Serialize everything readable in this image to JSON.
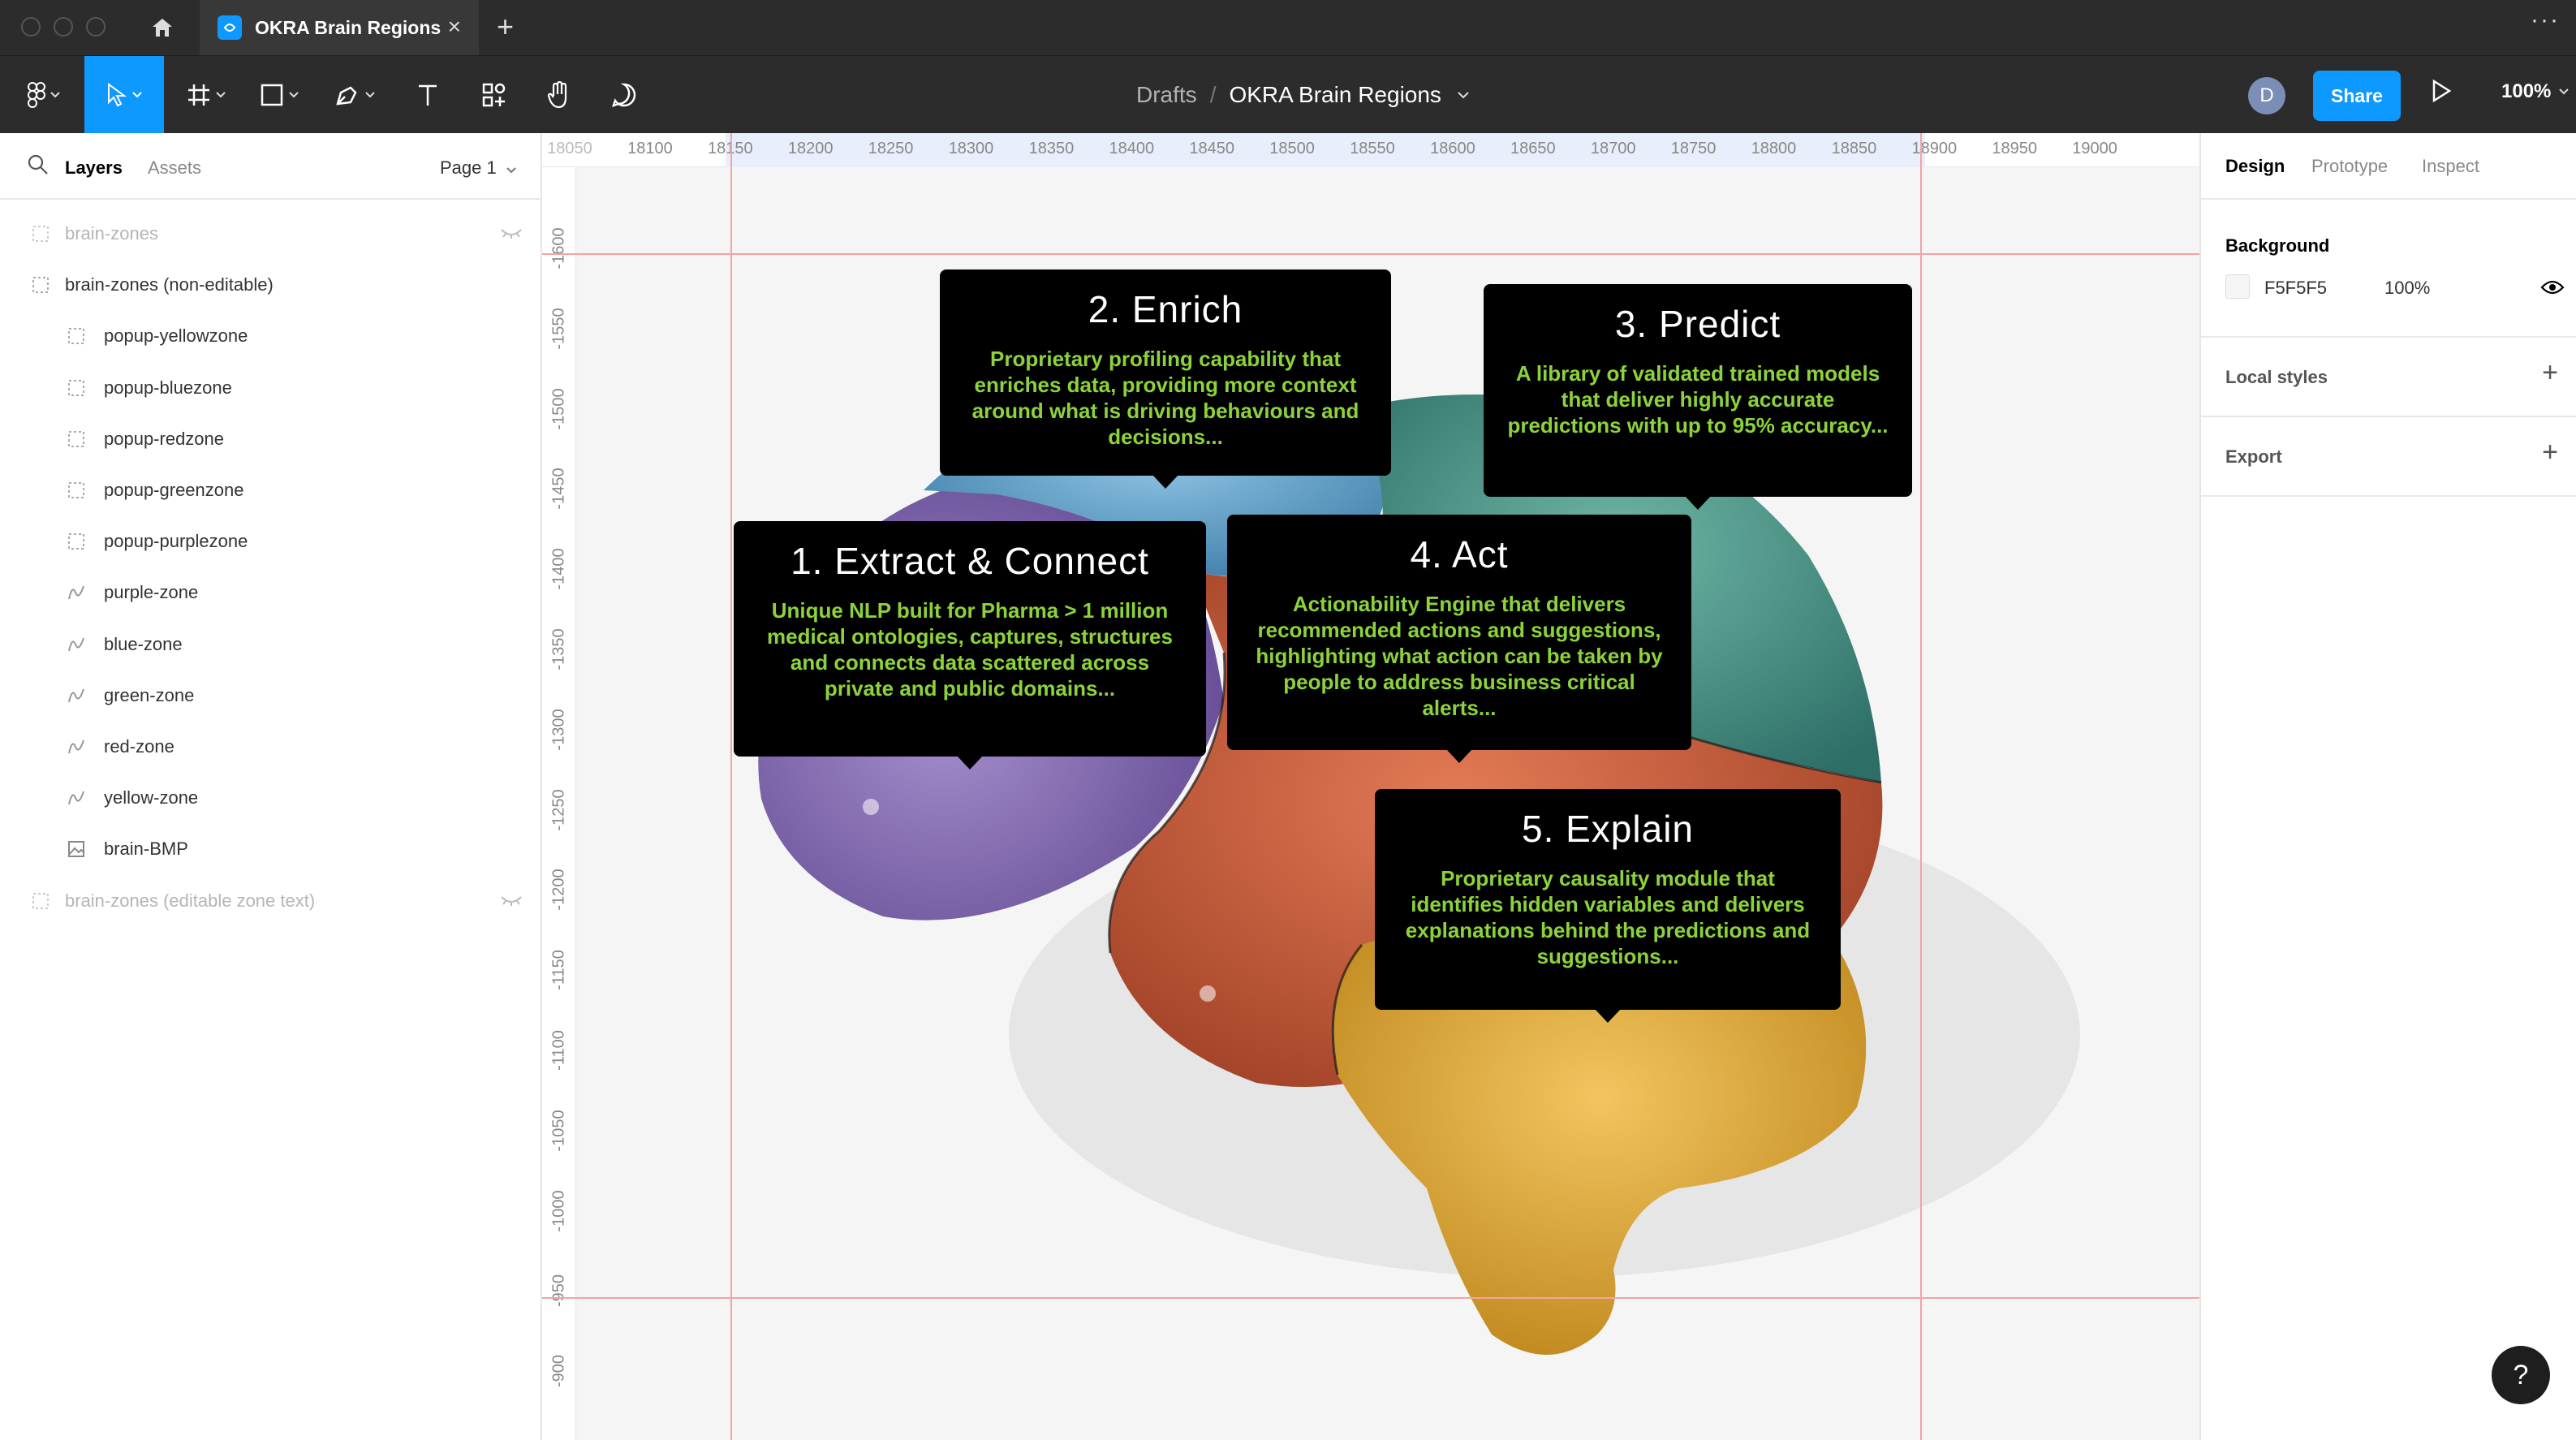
{
  "window": {
    "tab_title": "OKRA Brain Regions",
    "icons": [
      "home-icon",
      "figma-logo-icon",
      "close-icon",
      "plus-icon",
      "more-icon"
    ]
  },
  "toolbar": {
    "breadcrumb_drafts": "Drafts",
    "breadcrumb_sep": "/",
    "file_name": "OKRA Brain Regions",
    "avatar_initial": "D",
    "share_label": "Share",
    "zoom_label": "100%"
  },
  "left_panel": {
    "tab_layers": "Layers",
    "tab_assets": "Assets",
    "page_label": "Page 1",
    "layers": [
      {
        "name": "brain-zones",
        "type": "frame",
        "hidden": true
      },
      {
        "name": "brain-zones (non-editable)",
        "type": "frame",
        "hidden": false
      },
      {
        "name": "popup-yellowzone",
        "type": "frame",
        "hidden": false
      },
      {
        "name": "popup-bluezone",
        "type": "frame",
        "hidden": false
      },
      {
        "name": "popup-redzone",
        "type": "frame",
        "hidden": false
      },
      {
        "name": "popup-greenzone",
        "type": "frame",
        "hidden": false
      },
      {
        "name": "popup-purplezone",
        "type": "frame",
        "hidden": false
      },
      {
        "name": "purple-zone",
        "type": "vector",
        "hidden": false
      },
      {
        "name": "blue-zone",
        "type": "vector",
        "hidden": false
      },
      {
        "name": "green-zone",
        "type": "vector",
        "hidden": false
      },
      {
        "name": "red-zone",
        "type": "vector",
        "hidden": false
      },
      {
        "name": "yellow-zone",
        "type": "vector",
        "hidden": false
      },
      {
        "name": "brain-BMP",
        "type": "image",
        "hidden": false
      },
      {
        "name": "brain-zones (editable zone text)",
        "type": "frame",
        "hidden": true
      }
    ]
  },
  "rulers": {
    "top": [
      "18050",
      "18100",
      "18150",
      "18200",
      "18250",
      "18300",
      "18350",
      "18400",
      "18450",
      "18500",
      "18550",
      "18600",
      "18650",
      "18700",
      "18750",
      "18800",
      "18850",
      "18900",
      "18950",
      "19000"
    ],
    "left": [
      "-1600",
      "-1550",
      "-1500",
      "-1450",
      "-1400",
      "-1350",
      "-1300",
      "-1250",
      "-1200",
      "-1150",
      "-1100",
      "-1050",
      "-1000",
      "-950",
      "-900"
    ]
  },
  "popups": [
    {
      "id": "enrich",
      "title": "2. Enrich",
      "body": "Proprietary profiling capability that enriches data, providing more context around what is driving behaviours and decisions..."
    },
    {
      "id": "predict",
      "title": "3. Predict",
      "body": "A library of validated trained models that deliver highly accurate predictions with up to 95% accuracy..."
    },
    {
      "id": "extract",
      "title": "1. Extract & Connect",
      "body": "Unique NLP built for Pharma > 1 million medical ontologies, captures, structures and connects data scattered across private and public domains..."
    },
    {
      "id": "act",
      "title": "4. Act",
      "body": "Actionability Engine that delivers recommended actions and suggestions, highlighting what action can be taken by people to address business critical alerts..."
    },
    {
      "id": "explain",
      "title": "5. Explain",
      "body": "Proprietary causality module that identifies hidden variables and delivers explanations behind the predictions and suggestions..."
    }
  ],
  "right_panel": {
    "tab_design": "Design",
    "tab_prototype": "Prototype",
    "tab_inspect": "Inspect",
    "background_label": "Background",
    "background_hex": "F5F5F5",
    "background_opacity": "100%",
    "local_styles_label": "Local styles",
    "export_label": "Export"
  },
  "help_label": "?",
  "colors": {
    "accent": "#0d99ff",
    "popup_text": "#8cd33a",
    "zone_purple": "#7d63a6",
    "zone_blue": "#4f8fb5",
    "zone_green": "#3f8a7f",
    "zone_red": "#b8502f",
    "zone_yellow": "#d9a12a",
    "guide": "#f5a3a3"
  }
}
